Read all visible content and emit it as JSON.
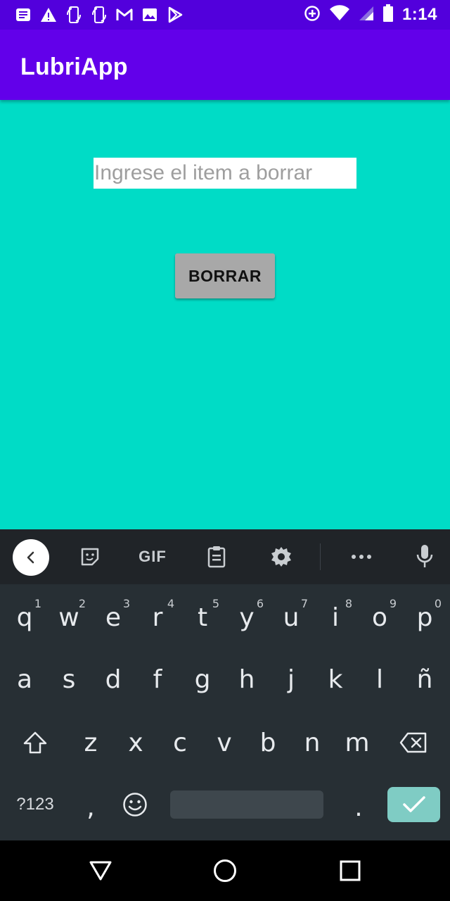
{
  "status_bar": {
    "time": "1:14",
    "left_icons": [
      "notification-icon",
      "warning-icon",
      "sync-phone-icon",
      "sync-phone-icon",
      "gmail-icon",
      "image-icon",
      "play-store-icon"
    ],
    "right_icons": [
      "data-saver-icon",
      "wifi-icon",
      "signal-icon",
      "battery-icon"
    ]
  },
  "app_bar": {
    "title": "LubriApp"
  },
  "form": {
    "input_placeholder": "Ingrese el item a borrar",
    "input_value": "",
    "button_label": "BORRAR"
  },
  "keyboard": {
    "toolbar": {
      "gif_label": "GIF",
      "icons": [
        "back-chevron-icon",
        "sticker-icon",
        "gif-icon",
        "clipboard-icon",
        "settings-gear-icon",
        "more-icon",
        "microphone-icon"
      ]
    },
    "row1": [
      {
        "char": "q",
        "sup": "1"
      },
      {
        "char": "w",
        "sup": "2"
      },
      {
        "char": "e",
        "sup": "3"
      },
      {
        "char": "r",
        "sup": "4"
      },
      {
        "char": "t",
        "sup": "5"
      },
      {
        "char": "y",
        "sup": "6"
      },
      {
        "char": "u",
        "sup": "7"
      },
      {
        "char": "i",
        "sup": "8"
      },
      {
        "char": "o",
        "sup": "9"
      },
      {
        "char": "p",
        "sup": "0"
      }
    ],
    "row2": [
      "a",
      "s",
      "d",
      "f",
      "g",
      "h",
      "j",
      "k",
      "l",
      "ñ"
    ],
    "row3": [
      "z",
      "x",
      "c",
      "v",
      "b",
      "n",
      "m"
    ],
    "row4": {
      "symbols_label": "?123",
      "comma": ",",
      "period": "."
    }
  },
  "colors": {
    "status_bar": "#5200dc",
    "app_bar": "#6200ea",
    "content_background": "#00dcc6",
    "button_background": "#a8a8a8",
    "keyboard_background": "#272f34",
    "enter_key": "#7fccc4"
  }
}
